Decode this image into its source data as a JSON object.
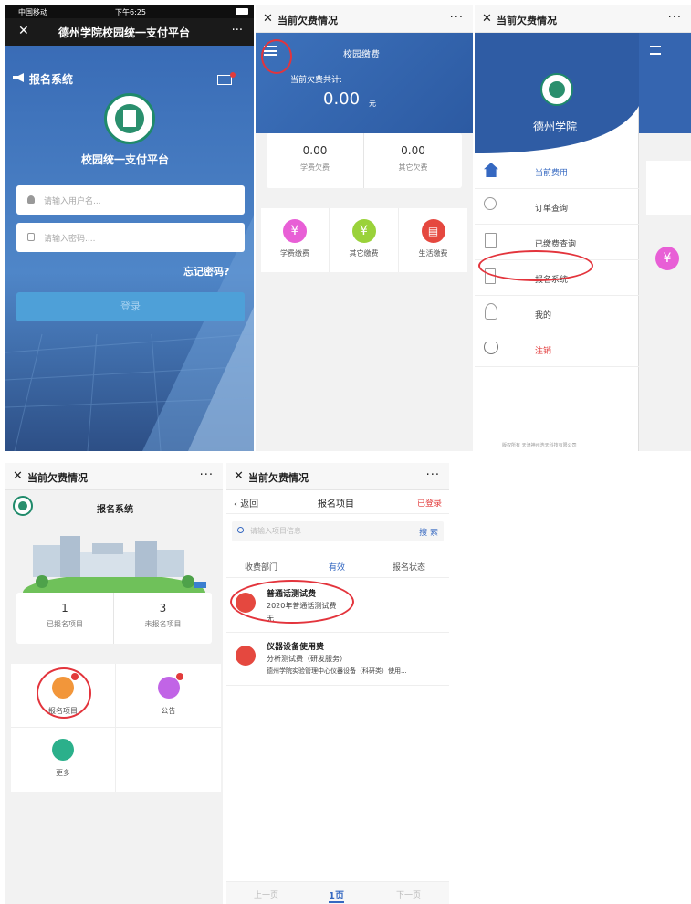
{
  "p1": {
    "status_carrier": "中国移动",
    "status_time": "下午6:25",
    "close_glyph": "✕",
    "nav_title": "德州学院校园统一支付平台",
    "more_glyph": "···",
    "brand": "报名系统",
    "platform_title": "校园统一支付平台",
    "username_placeholder": "请输入用户名...",
    "password_placeholder": "请输入密码....",
    "forgot": "忘记密码?",
    "login": "登录"
  },
  "p2": {
    "top_title": "当前欠费情况",
    "header_title": "校园缴费",
    "total_label": "当前欠费共计:",
    "total_value": "0.00",
    "total_unit": "元",
    "stats": [
      {
        "value": "0.00",
        "label": "学费欠费"
      },
      {
        "value": "0.00",
        "label": "其它欠费"
      }
    ],
    "actions": [
      {
        "label": "学费缴费",
        "color": "#e85fd6"
      },
      {
        "label": "其它缴费",
        "color": "#9ad23a"
      },
      {
        "label": "生活缴费",
        "color": "#e5483f"
      }
    ]
  },
  "p3": {
    "top_title": "当前欠费情况",
    "school": "德州学院",
    "menu": [
      {
        "label": "当前费用",
        "icon": "home-icon",
        "active": true
      },
      {
        "label": "订单查询",
        "icon": "search-icon",
        "active": false
      },
      {
        "label": "已缴费查询",
        "icon": "document-icon",
        "active": false
      },
      {
        "label": "报名系统",
        "icon": "edit-icon",
        "active": false
      },
      {
        "label": "我的",
        "icon": "user-icon",
        "active": false
      },
      {
        "label": "注销",
        "icon": "power-icon",
        "active": false,
        "danger": true
      }
    ],
    "footer": "版权所有 天津神州浩天科技有限公司"
  },
  "p4": {
    "top_title": "当前欠费情况",
    "title": "报名系统",
    "stats": [
      {
        "value": "1",
        "label": "已报名项目"
      },
      {
        "value": "3",
        "label": "未报名项目"
      }
    ],
    "tiles": [
      {
        "label": "报名项目",
        "color": "#f2963a"
      },
      {
        "label": "公告",
        "color": "#c164e6"
      },
      {
        "label": "更多",
        "color": "#2bb08b"
      }
    ]
  },
  "p5": {
    "top_title": "当前欠费情况",
    "back": "返回",
    "title": "报名项目",
    "logged": "已登录",
    "search_placeholder": "请输入项目信息",
    "search_btn": "搜 索",
    "filters": [
      "收费部门",
      "有效",
      "报名状态"
    ],
    "items": [
      {
        "title": "普通话测试费",
        "line1": "2020年普通话测试费",
        "line2": "无"
      },
      {
        "title": "仪器设备使用费",
        "line1": "分析测试费（研发服务）",
        "line2": "德州学院实验管理中心仪器设备（科研类）使用..."
      }
    ],
    "prev": "上一页",
    "page": "1页",
    "next": "下一页"
  }
}
